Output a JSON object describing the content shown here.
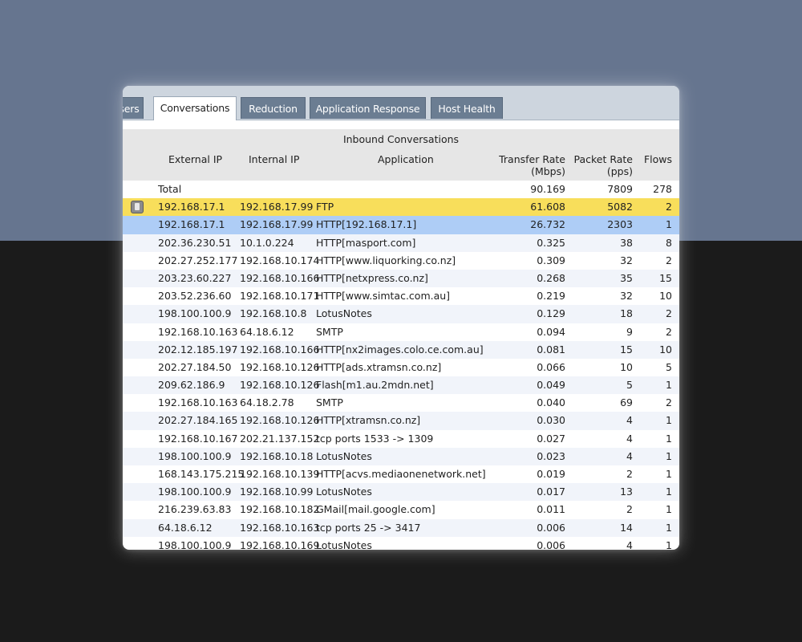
{
  "tabs": [
    {
      "label": "sers",
      "active": false
    },
    {
      "label": "Conversations",
      "active": true
    },
    {
      "label": "Reduction",
      "active": false
    },
    {
      "label": "Application Response",
      "active": false
    },
    {
      "label": "Host Health",
      "active": false
    }
  ],
  "section_title": "Inbound Conversations",
  "columns": {
    "external_ip": "External IP",
    "internal_ip": "Internal IP",
    "application": "Application",
    "transfer_rate": "Transfer Rate",
    "transfer_rate_unit": "(Mbps)",
    "packet_rate": "Packet Rate",
    "packet_rate_unit": "(pps)",
    "flows": "Flows"
  },
  "total": {
    "label": "Total",
    "transfer_rate": "90.169",
    "packet_rate": "7809",
    "flows": "278"
  },
  "rows": [
    {
      "ext": "192.168.17.1",
      "int": "192.168.17.99",
      "app": "FTP",
      "rate": "61.608",
      "pkt": "5082",
      "flows": "2",
      "highlight": "yellow",
      "icon": "device-icon"
    },
    {
      "ext": "192.168.17.1",
      "int": "192.168.17.99",
      "app": "HTTP[192.168.17.1]",
      "rate": "26.732",
      "pkt": "2303",
      "flows": "1",
      "highlight": "blue"
    },
    {
      "ext": "202.36.230.51",
      "int": "10.1.0.224",
      "app": "HTTP[masport.com]",
      "rate": "0.325",
      "pkt": "38",
      "flows": "8"
    },
    {
      "ext": "202.27.252.177",
      "int": "192.168.10.174",
      "app": "HTTP[www.liquorking.co.nz]",
      "rate": "0.309",
      "pkt": "32",
      "flows": "2"
    },
    {
      "ext": "203.23.60.227",
      "int": "192.168.10.166",
      "app": "HTTP[netxpress.co.nz]",
      "rate": "0.268",
      "pkt": "35",
      "flows": "15"
    },
    {
      "ext": "203.52.236.60",
      "int": "192.168.10.171",
      "app": "HTTP[www.simtac.com.au]",
      "rate": "0.219",
      "pkt": "32",
      "flows": "10"
    },
    {
      "ext": "198.100.100.9",
      "int": "192.168.10.8",
      "app": "LotusNotes",
      "rate": "0.129",
      "pkt": "18",
      "flows": "2"
    },
    {
      "ext": "192.168.10.163",
      "int": "64.18.6.12",
      "app": "SMTP",
      "rate": "0.094",
      "pkt": "9",
      "flows": "2"
    },
    {
      "ext": "202.12.185.197",
      "int": "192.168.10.166",
      "app": "HTTP[nx2images.colo.ce.com.au]",
      "rate": "0.081",
      "pkt": "15",
      "flows": "10"
    },
    {
      "ext": "202.27.184.50",
      "int": "192.168.10.126",
      "app": "HTTP[ads.xtramsn.co.nz]",
      "rate": "0.066",
      "pkt": "10",
      "flows": "5"
    },
    {
      "ext": "209.62.186.9",
      "int": "192.168.10.126",
      "app": "Flash[m1.au.2mdn.net]",
      "rate": "0.049",
      "pkt": "5",
      "flows": "1"
    },
    {
      "ext": "192.168.10.163",
      "int": "64.18.2.78",
      "app": "SMTP",
      "rate": "0.040",
      "pkt": "69",
      "flows": "2"
    },
    {
      "ext": "202.27.184.165",
      "int": "192.168.10.126",
      "app": "HTTP[xtramsn.co.nz]",
      "rate": "0.030",
      "pkt": "4",
      "flows": "1"
    },
    {
      "ext": "192.168.10.167",
      "int": "202.21.137.152",
      "app": "tcp ports 1533 -> 1309",
      "rate": "0.027",
      "pkt": "4",
      "flows": "1"
    },
    {
      "ext": "198.100.100.9",
      "int": "192.168.10.18",
      "app": "LotusNotes",
      "rate": "0.023",
      "pkt": "4",
      "flows": "1"
    },
    {
      "ext": "168.143.175.215",
      "int": "192.168.10.139",
      "app": "HTTP[acvs.mediaonenetwork.net]",
      "rate": "0.019",
      "pkt": "2",
      "flows": "1"
    },
    {
      "ext": "198.100.100.9",
      "int": "192.168.10.99",
      "app": "LotusNotes",
      "rate": "0.017",
      "pkt": "13",
      "flows": "1"
    },
    {
      "ext": "216.239.63.83",
      "int": "192.168.10.182",
      "app": "GMail[mail.google.com]",
      "rate": "0.011",
      "pkt": "2",
      "flows": "1"
    },
    {
      "ext": "64.18.6.12",
      "int": "192.168.10.163",
      "app": "tcp ports 25 -> 3417",
      "rate": "0.006",
      "pkt": "14",
      "flows": "1"
    },
    {
      "ext": "198.100.100.9",
      "int": "192.168.10.169",
      "app": "LotusNotes",
      "rate": "0.006",
      "pkt": "4",
      "flows": "1"
    }
  ],
  "colors": {
    "highlight_yellow": "#f8de5b",
    "highlight_blue": "#aecdf6",
    "tab_inactive": "#6b7d92"
  }
}
